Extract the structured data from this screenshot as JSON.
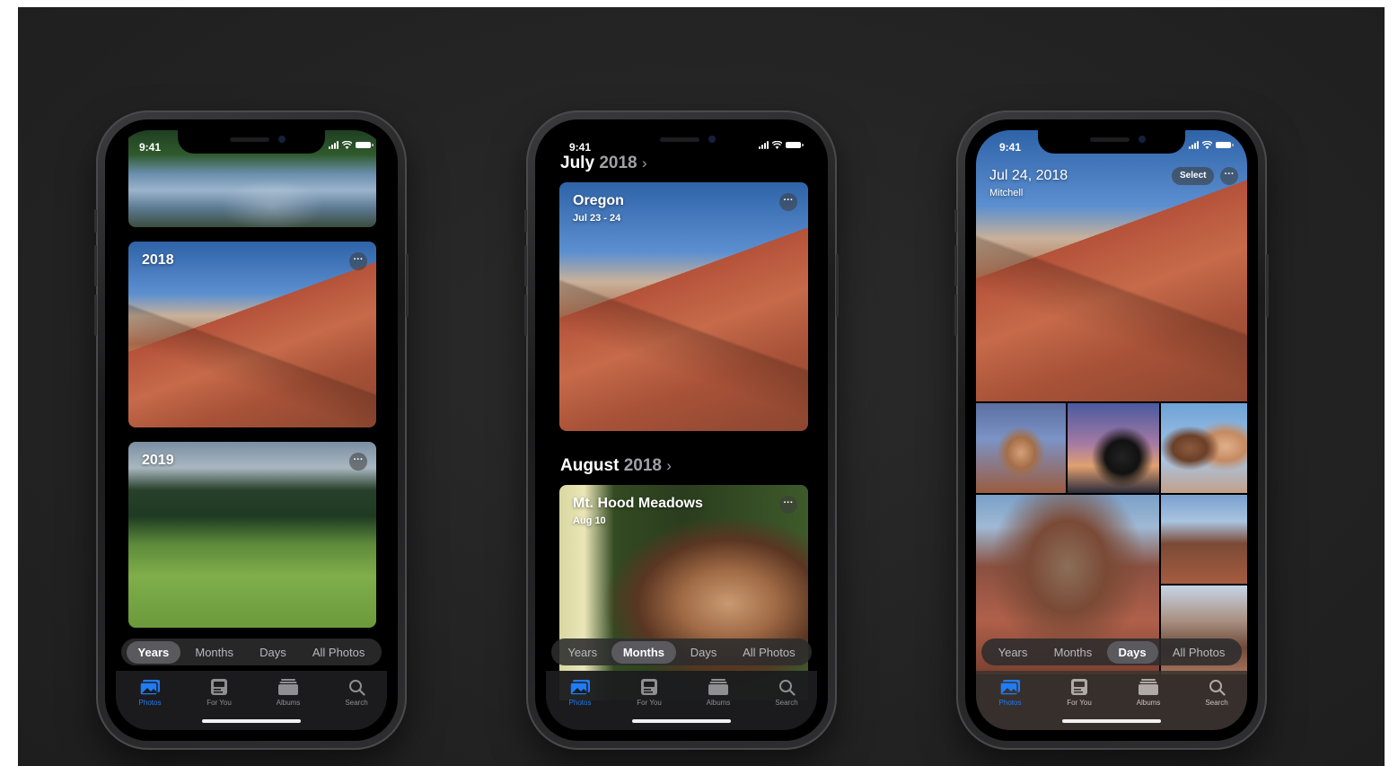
{
  "status": {
    "time": "9:41"
  },
  "segments": [
    "Years",
    "Months",
    "Days",
    "All Photos"
  ],
  "tabs": [
    {
      "label": "Photos",
      "icon": "photos-icon"
    },
    {
      "label": "For You",
      "icon": "for-you-icon"
    },
    {
      "label": "Albums",
      "icon": "albums-icon"
    },
    {
      "label": "Search",
      "icon": "search-icon"
    }
  ],
  "colors": {
    "accent": "#1f7cf5",
    "background": "#232323",
    "segment_selected": "#5a5a5e"
  },
  "phone1": {
    "selected_segment": "Years",
    "cards": [
      {
        "title": "2018",
        "more": "···"
      },
      {
        "title": "2019",
        "more": "···"
      }
    ]
  },
  "phone2": {
    "selected_segment": "Months",
    "sections": [
      {
        "month": "July",
        "year": "2018",
        "chevron": "›",
        "card": {
          "title": "Oregon",
          "subtitle": "Jul 23 - 24",
          "more": "···"
        }
      },
      {
        "month": "August",
        "year": "2018",
        "chevron": "›",
        "card": {
          "title": "Mt. Hood Meadows",
          "subtitle": "Aug 10",
          "more": "···"
        }
      }
    ]
  },
  "phone3": {
    "selected_segment": "Days",
    "date": "Jul 24, 2018",
    "location": "Mitchell",
    "select_label": "Select",
    "more": "···"
  }
}
